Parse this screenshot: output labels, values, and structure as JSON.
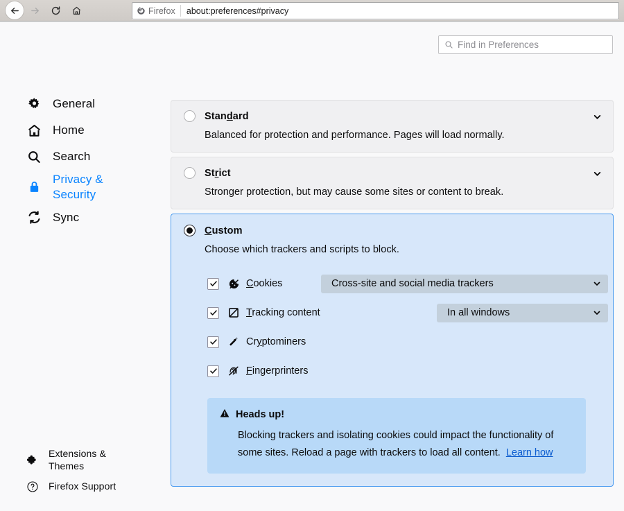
{
  "browser": {
    "back_icon": "back-arrow-icon",
    "forward_icon": "forward-arrow-icon",
    "reload_icon": "reload-icon",
    "home_icon": "home-icon",
    "identity_label": "Firefox",
    "identity_icon": "firefox-logo-icon",
    "url": "about:preferences#privacy"
  },
  "search": {
    "placeholder": "Find in Preferences",
    "icon": "search-icon"
  },
  "sidebar": {
    "items": [
      {
        "label": "General",
        "icon": "gear-icon",
        "active": false
      },
      {
        "label": "Home",
        "icon": "home-icon",
        "active": false
      },
      {
        "label": "Search",
        "icon": "search-icon",
        "active": false
      },
      {
        "label": "Privacy & Security",
        "icon": "lock-icon",
        "active": true
      },
      {
        "label": "Sync",
        "icon": "sync-icon",
        "active": false
      }
    ],
    "bottom_items": [
      {
        "label": "Extensions & Themes",
        "icon": "puzzle-piece-icon"
      },
      {
        "label": "Firefox Support",
        "icon": "question-mark-icon"
      }
    ]
  },
  "protection_levels": [
    {
      "id": "standard",
      "title_pre": "Stan",
      "title_key": "d",
      "title_post": "ard",
      "description": "Balanced for protection and performance. Pages will load normally.",
      "selected": false,
      "expandable": true
    },
    {
      "id": "strict",
      "title_pre": "St",
      "title_key": "r",
      "title_post": "ict",
      "description": "Stronger protection, but may cause some sites or content to break.",
      "selected": false,
      "expandable": true
    }
  ],
  "custom": {
    "title_pre": "",
    "title_key": "C",
    "title_post": "ustom",
    "description": "Choose which trackers and scripts to block.",
    "selected": true,
    "options": [
      {
        "id": "cookies",
        "label_pre": "",
        "label_key": "C",
        "label_post": "ookies",
        "icon": "cookie-blocked-icon",
        "checked": true,
        "dropdown": "Cross-site and social media trackers"
      },
      {
        "id": "tracking-content",
        "label_pre": "",
        "label_key": "T",
        "label_post": "racking content",
        "icon": "tracking-content-icon",
        "checked": true,
        "dropdown": "In all windows"
      },
      {
        "id": "cryptominers",
        "label_pre": "Cr",
        "label_key": "y",
        "label_post": "ptominers",
        "icon": "pickaxe-icon",
        "checked": true,
        "dropdown": null
      },
      {
        "id": "fingerprinters",
        "label_pre": "",
        "label_key": "F",
        "label_post": "ingerprinters",
        "icon": "fingerprint-icon",
        "checked": true,
        "dropdown": null
      }
    ],
    "warning": {
      "icon": "warning-triangle-icon",
      "title": "Heads up!",
      "body": "Blocking trackers and isolating cookies could impact the functionality of some sites. Reload a page with trackers to load all content.",
      "link": "Learn how"
    }
  },
  "colors": {
    "accent": "#0a84ff",
    "custom_panel_bg": "#d7e7fa",
    "custom_panel_border": "#4a9bf0",
    "warning_bg": "#b8d9f8",
    "card_bg": "#f0f0f2",
    "dropdown_bg": "#c3d0dc",
    "link": "#0a5bcf",
    "page_bg": "#f9f9fa"
  }
}
